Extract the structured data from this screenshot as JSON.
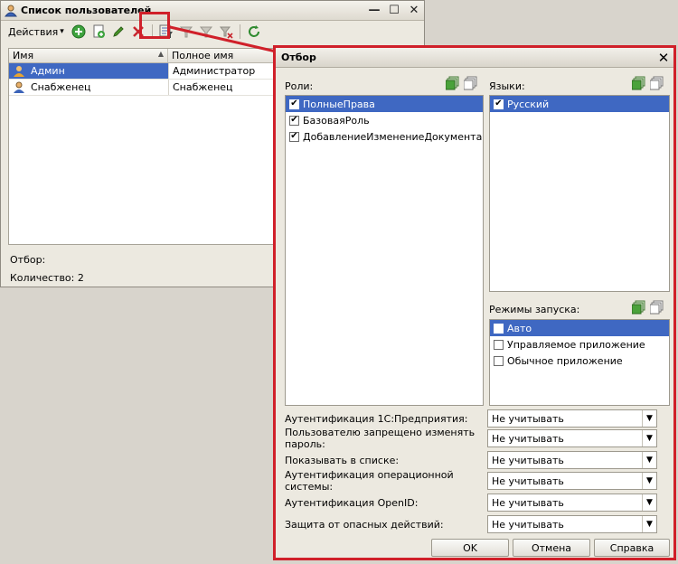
{
  "window": {
    "title": "Список пользователей",
    "minimize": "—",
    "maximize": "☐",
    "close": "✕"
  },
  "toolbar": {
    "actions_label": "Действия",
    "dropdown_glyph": "▾"
  },
  "grid": {
    "col_name": "Имя",
    "col_fullname": "Полное имя",
    "rows": [
      {
        "name": "Админ",
        "full": "Администратор"
      },
      {
        "name": "Снабженец",
        "full": "Снабженец"
      }
    ]
  },
  "footer": {
    "filter_label": "Отбор:",
    "count_label": "Количество: 2"
  },
  "dialog": {
    "title": "Отбор",
    "close": "✕",
    "roles_label": "Роли:",
    "roles": [
      {
        "label": "ПолныеПрава",
        "checked": true
      },
      {
        "label": "БазоваяРоль",
        "checked": true
      },
      {
        "label": "ДобавлениеИзменениеДокументаЗак...",
        "checked": true
      }
    ],
    "languages_label": "Языки:",
    "languages": [
      {
        "label": "Русский",
        "checked": true
      }
    ],
    "modes_label": "Режимы запуска:",
    "modes": [
      {
        "label": "Авто",
        "checked": false
      },
      {
        "label": "Управляемое приложение",
        "checked": false
      },
      {
        "label": "Обычное приложение",
        "checked": false
      }
    ],
    "check_glyph": "✔",
    "filters": [
      {
        "label": "Аутентификация 1С:Предприятия:",
        "value": "Не учитывать"
      },
      {
        "label": "Пользователю запрещено изменять пароль:",
        "value": "Не учитывать"
      },
      {
        "label": "Показывать в списке:",
        "value": "Не учитывать"
      },
      {
        "label": "Аутентификация операционной системы:",
        "value": "Не учитывать"
      },
      {
        "label": "Аутентификация OpenID:",
        "value": "Не учитывать"
      },
      {
        "label": "Защита от опасных действий:",
        "value": "Не учитывать"
      }
    ],
    "select_arrow": "▼",
    "ok": "OK",
    "cancel": "Отмена",
    "help": "Справка"
  },
  "icons": {
    "user_admin": "user-admin-icon",
    "user": "user-icon",
    "filter": "filter-icon",
    "refresh": "refresh-icon",
    "accent_red": "#d0202a",
    "selection_blue": "#3f68c2"
  }
}
